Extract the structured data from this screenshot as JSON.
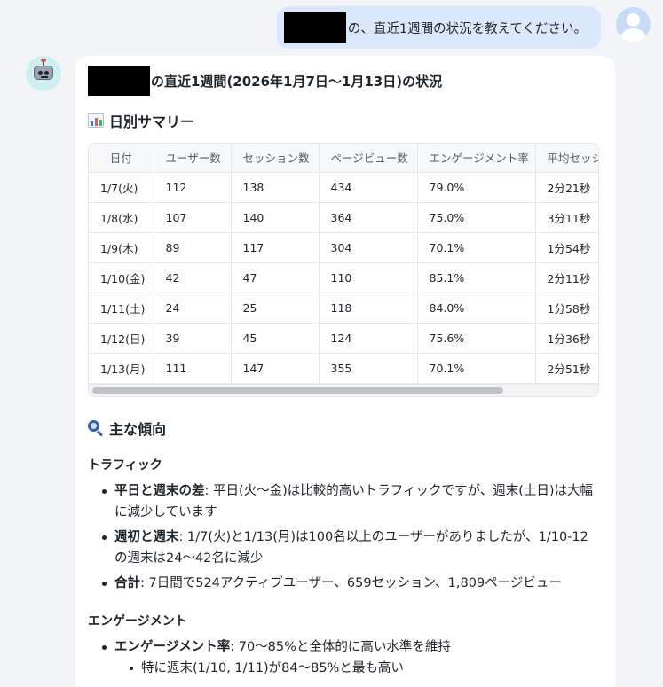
{
  "user_message": {
    "text": "の、直近1週間の状況を教えてください。"
  },
  "bot": {
    "title": "の直近1週間(2026年1月7日〜1月13日)の状況",
    "daily_heading": "日別サマリー",
    "table": {
      "headers": [
        "日付",
        "ユーザー数",
        "セッション数",
        "ページビュー数",
        "エンゲージメント率",
        "平均セッション時間"
      ],
      "rows": [
        [
          "1/7(火)",
          "112",
          "138",
          "434",
          "79.0%",
          "2分21秒"
        ],
        [
          "1/8(水)",
          "107",
          "140",
          "364",
          "75.0%",
          "3分11秒"
        ],
        [
          "1/9(木)",
          "89",
          "117",
          "304",
          "70.1%",
          "1分54秒"
        ],
        [
          "1/10(金)",
          "42",
          "47",
          "110",
          "85.1%",
          "2分11秒"
        ],
        [
          "1/11(土)",
          "24",
          "25",
          "118",
          "84.0%",
          "1分58秒"
        ],
        [
          "1/12(日)",
          "39",
          "45",
          "124",
          "75.6%",
          "1分36秒"
        ],
        [
          "1/13(月)",
          "111",
          "147",
          "355",
          "70.1%",
          "2分51秒"
        ]
      ]
    },
    "trends_heading": "主な傾向",
    "traffic": {
      "heading": "トラフィック",
      "items": [
        {
          "bold": "平日と週末の差",
          "text": ": 平日(火〜金)は比較的高いトラフィックですが、週末(土日)は大幅に減少しています"
        },
        {
          "bold": "週初と週末",
          "text": ": 1/7(火)と1/13(月)は100名以上のユーザーがありましたが、1/10-12の週末は24〜42名に減少"
        },
        {
          "bold": "合計",
          "text": ": 7日間で524アクティブユーザー、659セッション、1,809ページビュー"
        }
      ]
    },
    "engagement": {
      "heading": "エンゲージメント",
      "items": [
        {
          "bold": "エンゲージメント率",
          "text": ": 70〜85%と全体的に高い水準を維持"
        }
      ],
      "sub_items": [
        "特に週末(1/10, 1/11)が84〜85%と最も高い"
      ]
    }
  },
  "icons": {
    "user_avatar": "user-avatar-icon",
    "bot_avatar": "robot-icon",
    "daily_heading": "bar-chart-icon",
    "trends_heading": "magnifier-icon"
  }
}
